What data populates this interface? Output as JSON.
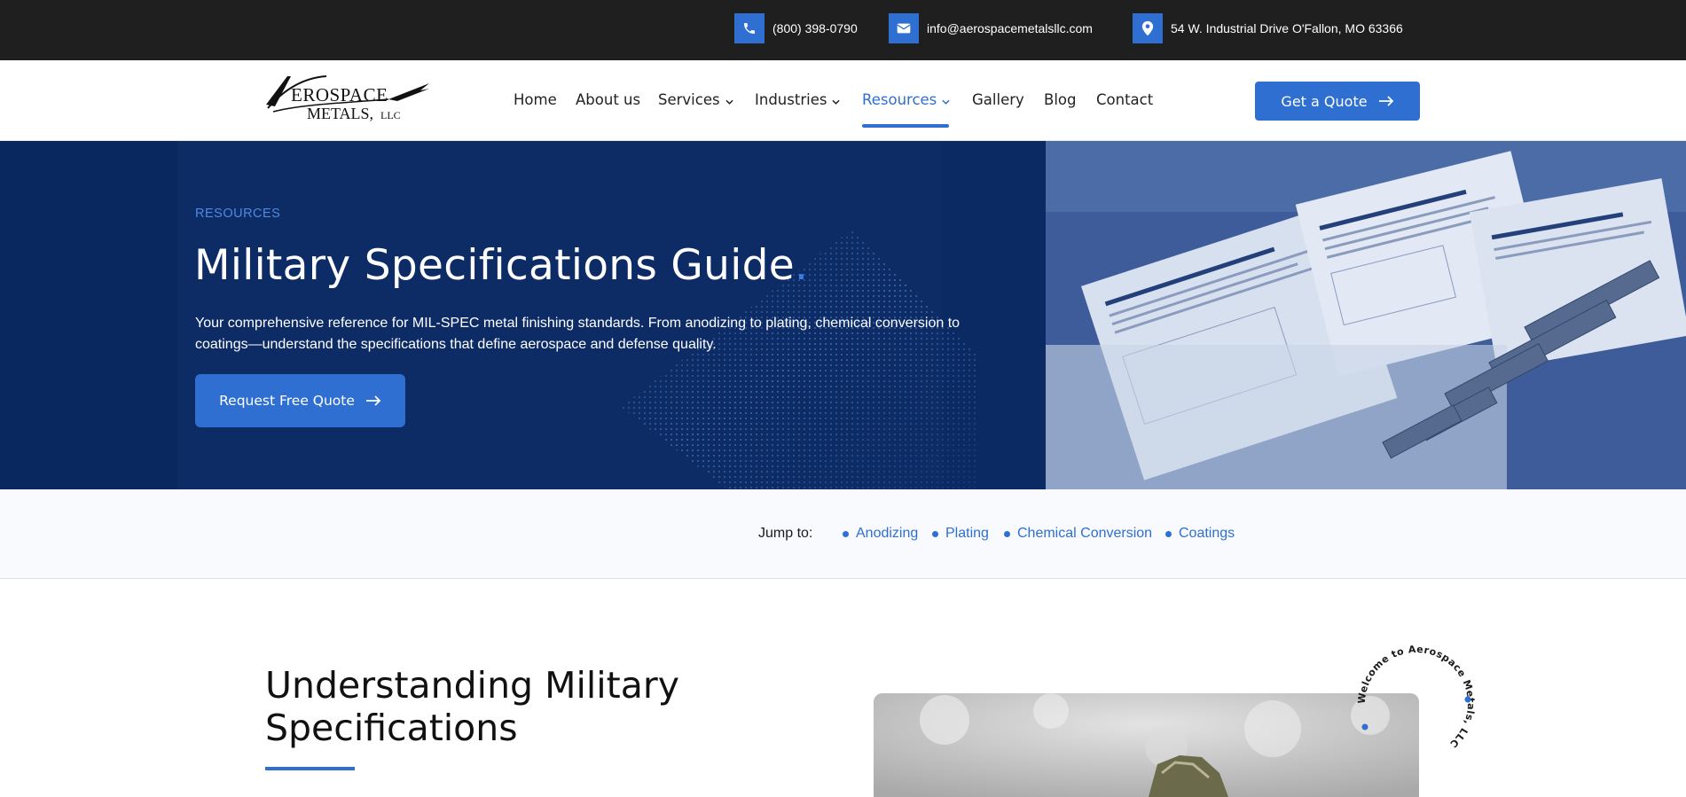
{
  "topbar": {
    "phone": "(800) 398-0790",
    "email": "info@aerospacemetalsllc.com",
    "address": "54 W. Industrial Drive O'Fallon, MO 63366",
    "icons": [
      "phone-icon",
      "envelope-icon",
      "map-pin-icon"
    ],
    "icon_color": "#2f6fd1"
  },
  "header": {
    "logo": {
      "line1": "AEROSPACE",
      "line2": "METALS, LLC"
    },
    "nav": [
      {
        "label": "Home"
      },
      {
        "label": "About us"
      },
      {
        "label": "Services",
        "dropdown": true
      },
      {
        "label": "Industries",
        "dropdown": true
      },
      {
        "label": "Resources",
        "dropdown": true,
        "active": true
      },
      {
        "label": "Gallery"
      },
      {
        "label": "Blog"
      },
      {
        "label": "Contact"
      }
    ],
    "cta": "Get a Quote"
  },
  "hero": {
    "eyebrow": "RESOURCES",
    "title": "Military Specifications Guide",
    "title_dot": ".",
    "description": "Your comprehensive reference for MIL-SPEC metal finishing standards. From anodizing to plating, chemical conversion to coatings—understand the specifications that define aerospace and defense quality.",
    "button": "Request Free Quote"
  },
  "jump": {
    "label": "Jump to:",
    "links": [
      "Anodizing",
      "Plating",
      "Chemical Conversion",
      "Coatings"
    ]
  },
  "content": {
    "title_line1": "Understanding Military",
    "title_line2": "Specifications",
    "badge_text": "Welcome to Aerospace Metals, LLC"
  },
  "colors": {
    "brand_blue": "#2f6fd1",
    "hero_navy": "#0d2c66",
    "topbar_bg": "#1f1f1f"
  }
}
